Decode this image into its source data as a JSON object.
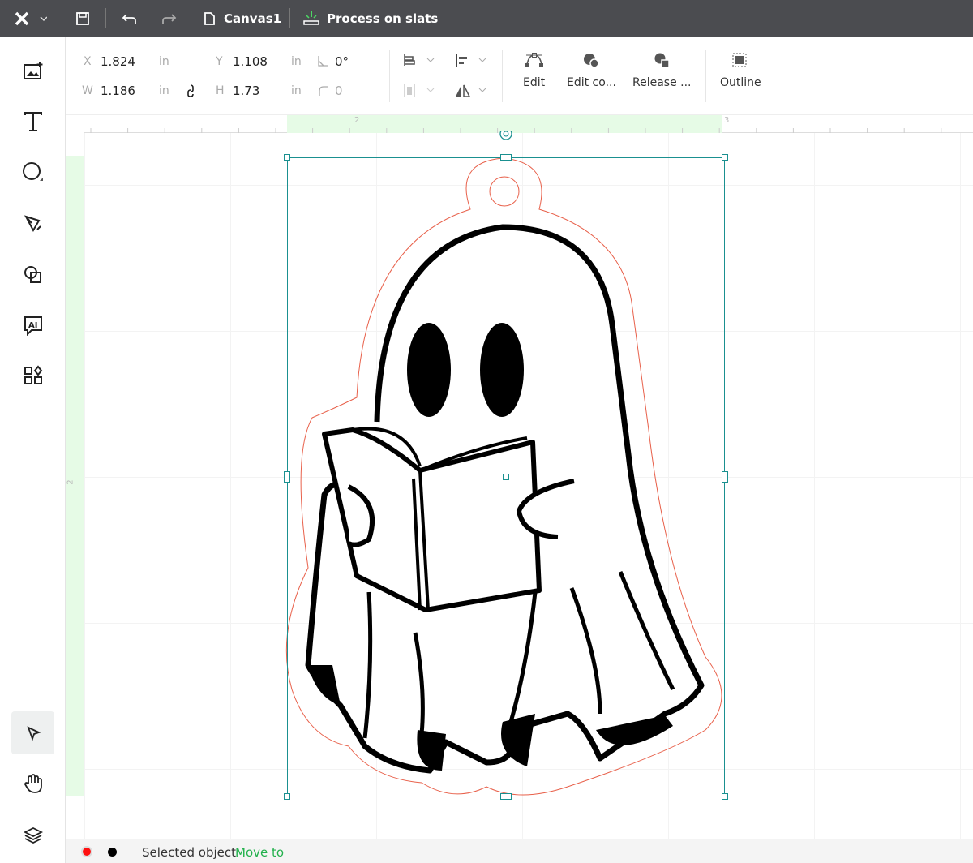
{
  "topbar": {
    "document_name": "Canvas1",
    "process_label": "Process on slats"
  },
  "properties": {
    "x_label": "X",
    "x_value": "1.824",
    "x_unit": "in",
    "y_label": "Y",
    "y_value": "1.108",
    "y_unit": "in",
    "w_label": "W",
    "w_value": "1.186",
    "w_unit": "in",
    "h_label": "H",
    "h_value": "1.73",
    "h_unit": "in",
    "rotation": "0°",
    "corner_radius": "0"
  },
  "toolbar": {
    "edit": "Edit",
    "edit_contour": "Edit co...",
    "release": "Release ...",
    "outline": "Outline"
  },
  "ruler": {
    "h_ticks": [
      "2",
      "3"
    ],
    "v_ticks": [
      "2"
    ]
  },
  "status": {
    "text": "Selected object",
    "action": "Move to",
    "color_red": "#ff1010",
    "color_black": "#000000",
    "accent": "#22b14c"
  },
  "colors": {
    "selection": "#1a9090",
    "cut_line": "#e8604a",
    "topbar": "#4b4c50"
  }
}
